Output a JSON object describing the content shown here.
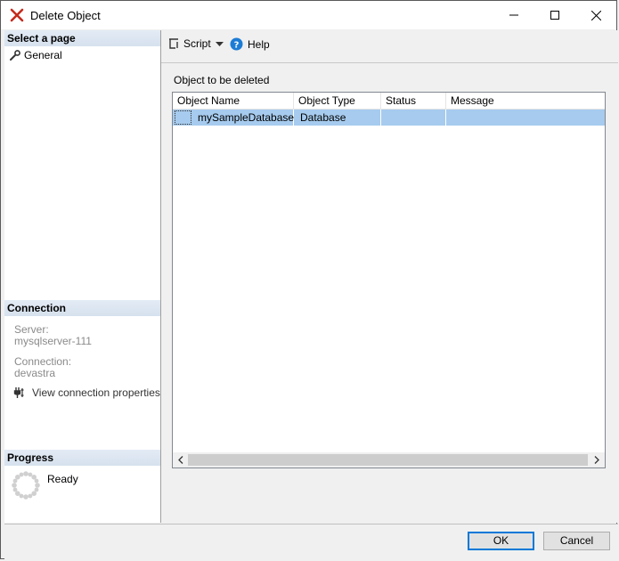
{
  "window": {
    "title": "Delete Object"
  },
  "left": {
    "select_page_header": "Select a page",
    "pages": [
      {
        "label": "General",
        "icon": "wrench-icon"
      }
    ],
    "connection_header": "Connection",
    "server_label": "Server:",
    "server_value": "mysqlserver-111",
    "connection_label": "Connection:",
    "connection_value": "devastra",
    "view_props_link": "View connection properties",
    "progress_header": "Progress",
    "progress_status": "Ready"
  },
  "toolbar": {
    "script_label": "Script",
    "help_label": "Help"
  },
  "grid": {
    "caption": "Object to be deleted",
    "columns": [
      "Object Name",
      "Object Type",
      "Status",
      "Message"
    ],
    "rows": [
      {
        "name": "mySampleDatabase",
        "type": "Database",
        "status": "",
        "message": ""
      }
    ]
  },
  "buttons": {
    "ok": "OK",
    "cancel": "Cancel"
  },
  "colors": {
    "selection": "#a6cbee",
    "section_header": "#d6e1ee",
    "close_icon": "#c42b1c",
    "help_icon": "#1c7cd5",
    "ok_border": "#0078d7"
  }
}
